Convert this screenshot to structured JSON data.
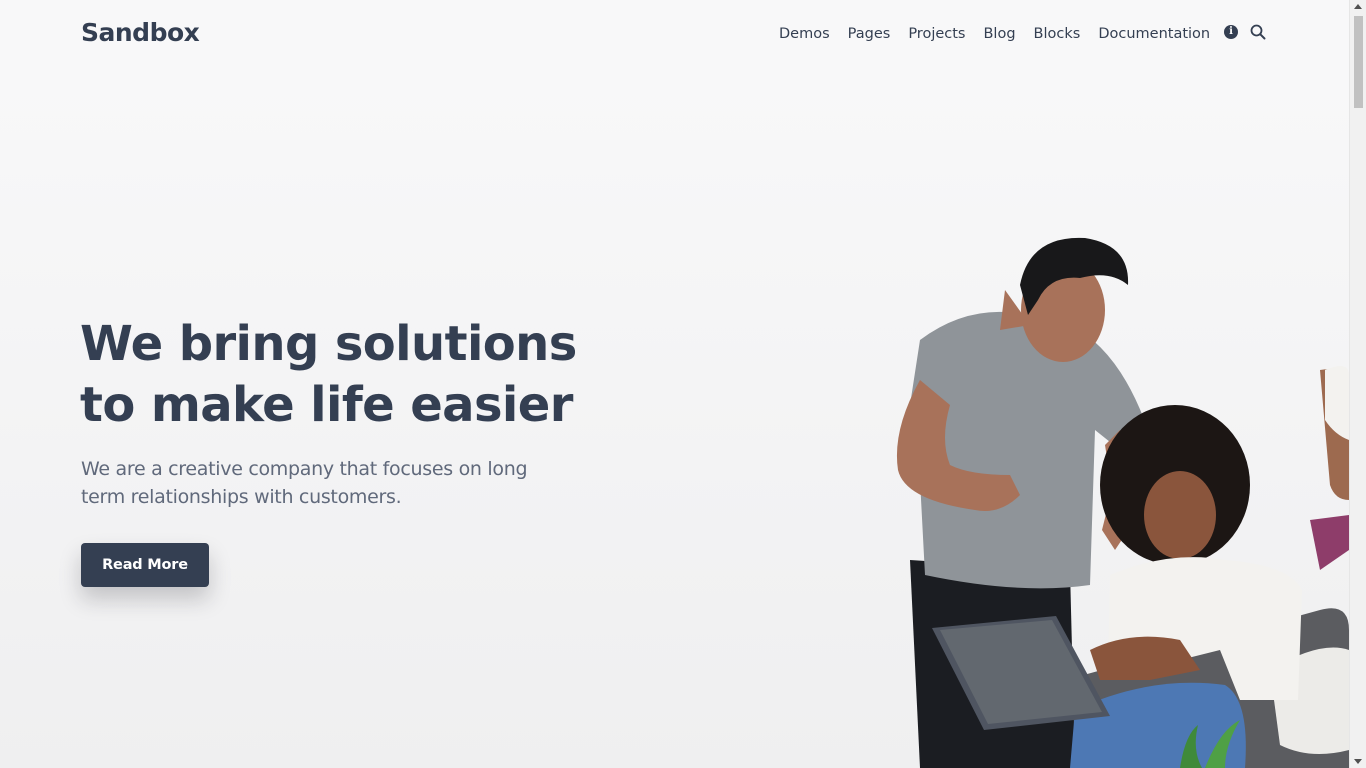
{
  "brand": {
    "logo_text": "Sandbox"
  },
  "nav": {
    "items": [
      {
        "label": "Demos"
      },
      {
        "label": "Pages"
      },
      {
        "label": "Projects"
      },
      {
        "label": "Blog"
      },
      {
        "label": "Blocks"
      },
      {
        "label": "Documentation"
      }
    ],
    "icons": [
      "info-icon",
      "search-icon"
    ]
  },
  "hero": {
    "title_line1": "We bring solutions",
    "title_line2": "to make life easier",
    "lead": "We are a creative company that focuses on long term relationships with customers.",
    "cta_label": "Read More"
  },
  "colors": {
    "primary": "#343f52",
    "muted_text": "#60697b",
    "background": "#f8f9fa"
  }
}
